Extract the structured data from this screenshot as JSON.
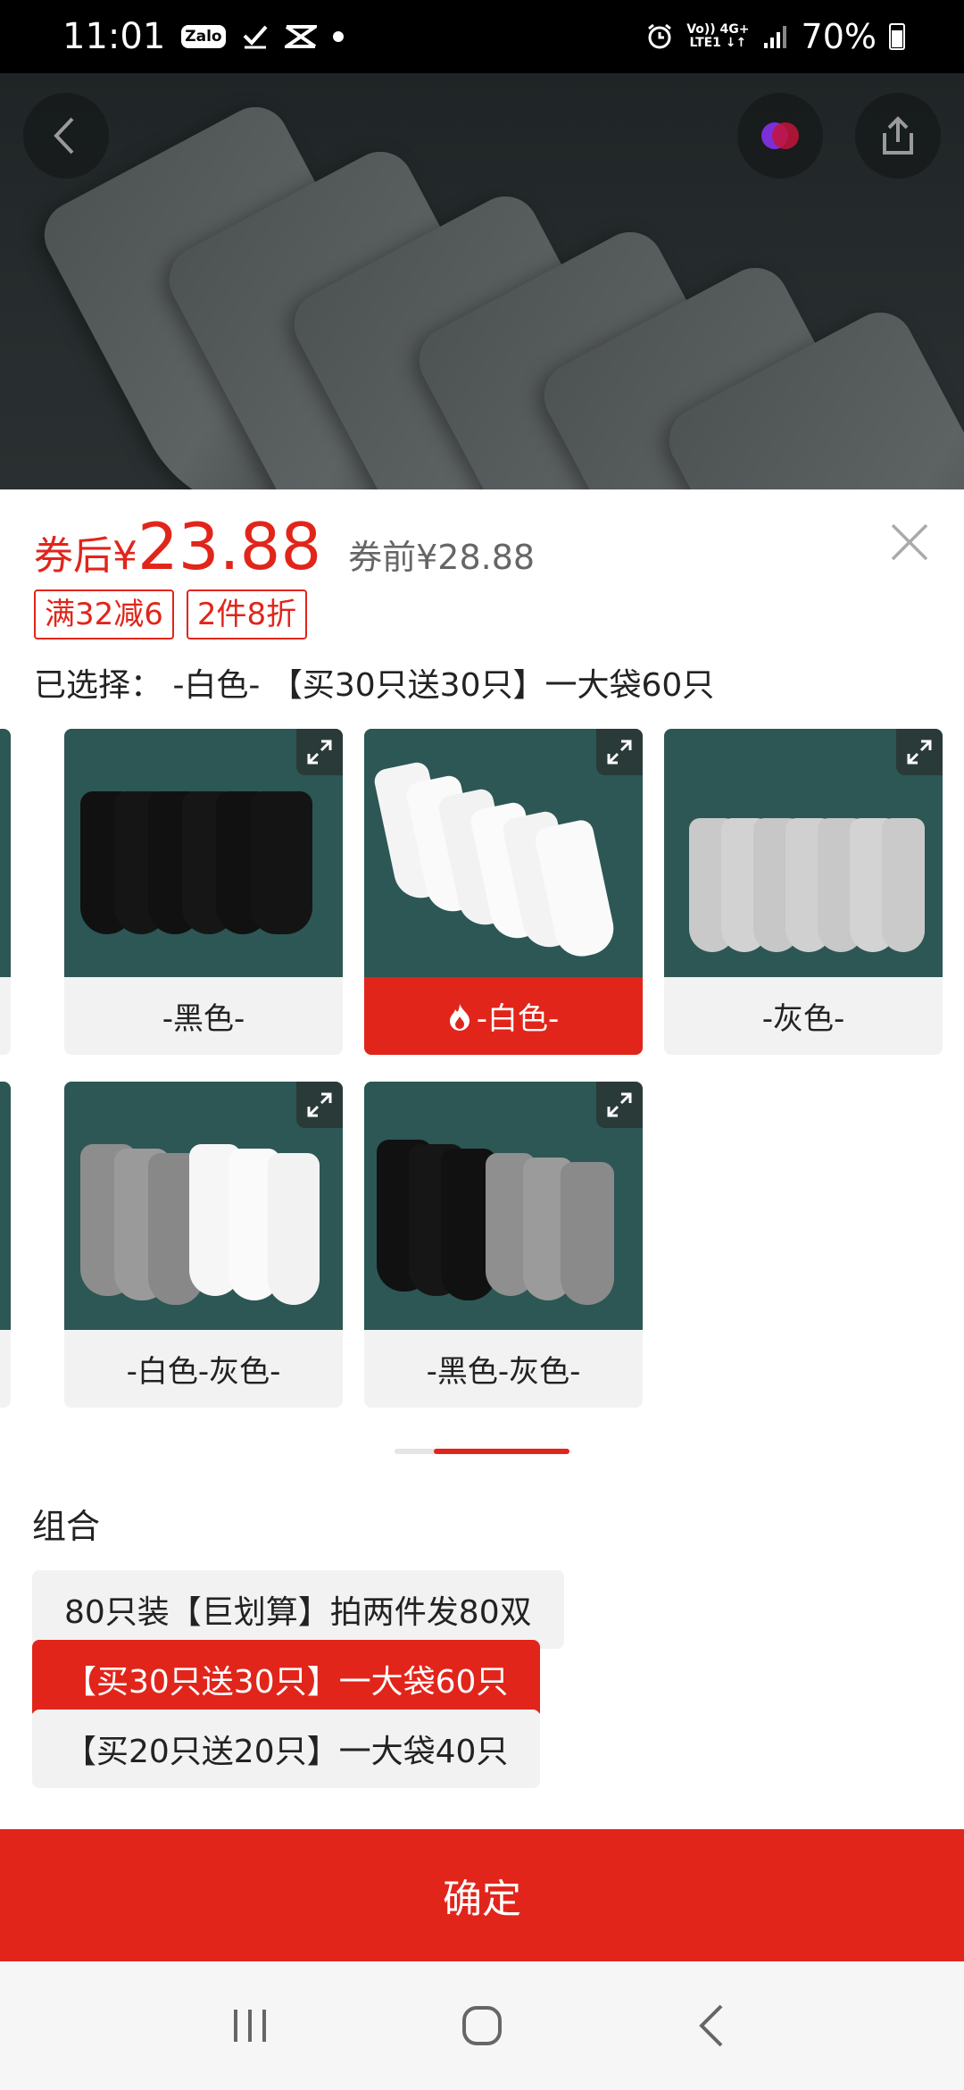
{
  "status_bar": {
    "time": "11:01",
    "zalo_label": "Zalo",
    "network_top": "Vo)) 4G+",
    "network_bottom": "LTE1 ↓↑",
    "battery": "70%"
  },
  "hero": {
    "back_icon": "chevron-left-icon",
    "share_icon": "share-icon"
  },
  "price": {
    "label": "券后",
    "currency": "¥",
    "value": "23.88",
    "before": "券前¥28.88"
  },
  "promos": [
    "满32减6",
    "2件8折"
  ],
  "selected_text": "已选择： -白色- 【买30只送30只】一大袋60只",
  "color_options": [
    {
      "label": "-黑色-",
      "selected": false
    },
    {
      "label": "-白色-",
      "selected": true
    },
    {
      "label": "-灰色-",
      "selected": false
    },
    {
      "label": "-白色-灰色-",
      "selected": false
    },
    {
      "label": "-黑色-灰色-",
      "selected": false
    }
  ],
  "group": {
    "title": "组合",
    "options": [
      {
        "label": "80只装【巨划算】拍两件发80双",
        "active": false
      },
      {
        "label": "【买30只送30只】一大袋60只",
        "active": true
      },
      {
        "label": "【买20只送20只】一大袋40只",
        "active": false
      }
    ]
  },
  "confirm_label": "确定",
  "colors": {
    "accent": "#e1251b",
    "tile_bg": "#2c5754"
  }
}
